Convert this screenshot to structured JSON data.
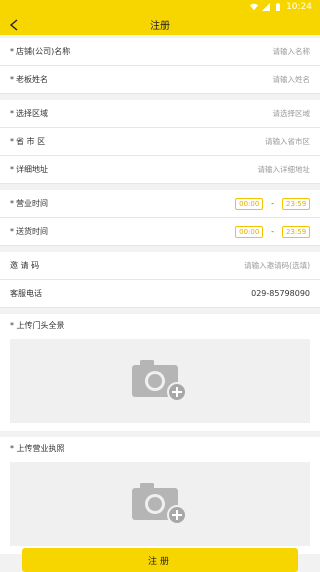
{
  "statusbar": {
    "time": "10:24"
  },
  "header": {
    "title": "注册"
  },
  "form": {
    "required_mark": "*",
    "shop_name": {
      "label": "店铺(公司)名称",
      "placeholder": "请输入名称"
    },
    "owner_name": {
      "label": "老板姓名",
      "placeholder": "请输入姓名"
    },
    "region": {
      "label": "选择区域",
      "placeholder": "请选择区域"
    },
    "province": {
      "label": "省 市 区",
      "placeholder": "请输入省市区"
    },
    "address": {
      "label": "详细地址",
      "placeholder": "请输入详细地址"
    },
    "business_hours": {
      "label": "营业时间",
      "start": "00:00",
      "sep": "-",
      "end": "23:59"
    },
    "delivery_hours": {
      "label": "送货时间",
      "start": "00:00",
      "sep": "-",
      "end": "23:59"
    },
    "invite_code": {
      "label": "邀 请 码",
      "placeholder": "请输入邀请码(选填)"
    },
    "service_phone": {
      "label": "客服电话",
      "value": "029-85798090"
    },
    "upload_storefront": {
      "label": "上传门头全景"
    },
    "upload_license": {
      "label": "上传营业执照"
    }
  },
  "submit": {
    "label": "注册"
  },
  "colors": {
    "accent": "#f7d600",
    "time_border": "#f2c500"
  },
  "icons": {
    "back": "chevron-left-icon",
    "camera": "camera-add-icon"
  }
}
